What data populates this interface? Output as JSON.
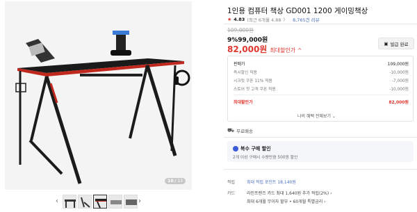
{
  "gallery": {
    "counter_current": "10",
    "counter_sep": " / ",
    "counter_total": "13",
    "prev_arrow": "‹",
    "next_arrow": "›"
  },
  "product": {
    "title": "1인용 컴퓨터 책상 GD001 1200 게이밍책상",
    "rating": "4.83",
    "rating_recent": "(최근 6개월 4.88",
    "rating_close": ")",
    "reviews": "8,765건 리뷰"
  },
  "price": {
    "original": "109,000원",
    "discount_line": "9%99,000원",
    "sale": "82,000원",
    "sale_label": "최대할인가 ^",
    "coupon_label": "발급 완료"
  },
  "breakdown": {
    "head_label": "판매가",
    "head_value": "109,000원",
    "rows": [
      {
        "label": "즉시할인 적용",
        "value": "-10,000원"
      },
      {
        "label": "시크릿 쿠폰 11% 적용",
        "value": "-7,000원"
      },
      {
        "label": "스토어 첫 고객 쿠폰 적용",
        "value": "-10,000원"
      }
    ],
    "max_label": "최대할인가",
    "max_value": "82,000원",
    "more": "나의 혜택 전체보기 ⌄"
  },
  "shipping": {
    "free": "무료배송",
    "icon": "truck-icon"
  },
  "promo": {
    "title": "복수 구매 할인",
    "desc": "2개 이상 구매시 수량만큼 500원 할인"
  },
  "points": {
    "label": "적립",
    "value": "최대 적립 포인트 18,140원"
  },
  "card": {
    "label": "카드",
    "line1": "라인프렌즈 카드 최대 1,640원 추가 적립(2%) ›",
    "line2": "최대 6개월 무이자 할부 • 60개월 특별금리 ›"
  },
  "colors": {
    "accent_red": "#e0362e",
    "link_blue": "#4a6fbf"
  }
}
